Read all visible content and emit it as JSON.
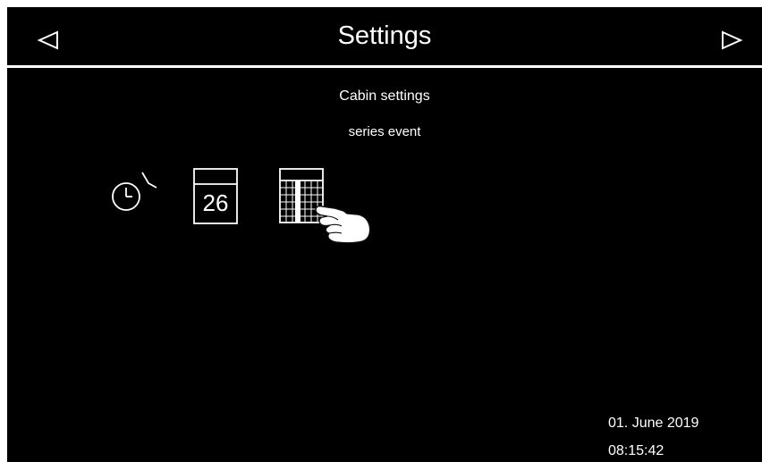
{
  "header": {
    "title": "Settings",
    "prev_icon": "triangle-left-icon",
    "next_icon": "triangle-right-icon"
  },
  "main": {
    "heading": "Cabin settings",
    "subheading": "series event",
    "tiles": [
      {
        "icon": "clock-icon"
      },
      {
        "icon": "calendar-day-icon",
        "label": "26"
      },
      {
        "icon": "calendar-month-grid-icon"
      }
    ],
    "pointer_icon": "hand-pointer-icon"
  },
  "footer": {
    "date": "01. June 2019",
    "time": "08:15:42"
  },
  "colors": {
    "background": "#000000",
    "foreground": "#ffffff",
    "border": "#ffffff"
  }
}
